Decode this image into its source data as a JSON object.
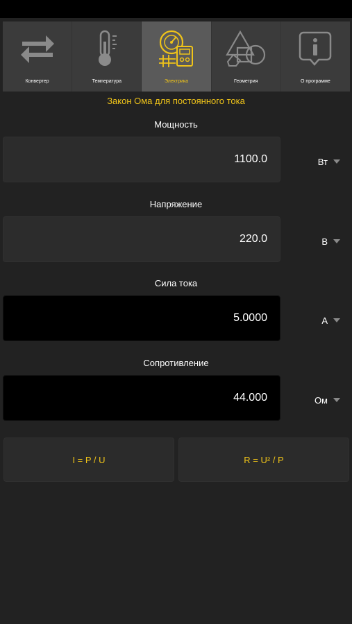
{
  "tabs": [
    {
      "label": "Конвертер",
      "icon": "arrows-swap-icon"
    },
    {
      "label": "Температура",
      "icon": "thermometer-icon"
    },
    {
      "label": "Электрика",
      "icon": "electrics-meter-icon",
      "active": true
    },
    {
      "label": "Геометрия",
      "icon": "shapes-icon"
    },
    {
      "label": "О программе",
      "icon": "info-icon"
    }
  ],
  "section_title": "Закон Ома для постоянного тока",
  "fields": {
    "power": {
      "label": "Мощность",
      "value": "1100.0",
      "unit": "Вт"
    },
    "voltage": {
      "label": "Напряжение",
      "value": "220.0",
      "unit": "В"
    },
    "current": {
      "label": "Сила тока",
      "value": "5.0000",
      "unit": "А"
    },
    "resistance": {
      "label": "Сопротивление",
      "value": "44.000",
      "unit": "Ом"
    }
  },
  "formulas": {
    "left": "I = P / U",
    "right": "R = U² / P"
  },
  "colors": {
    "accent": "#f0c419",
    "background": "#222222",
    "tab_active": "#5a5a5a",
    "tab_inactive": "#3b3b3b",
    "result_bg": "#000000"
  }
}
